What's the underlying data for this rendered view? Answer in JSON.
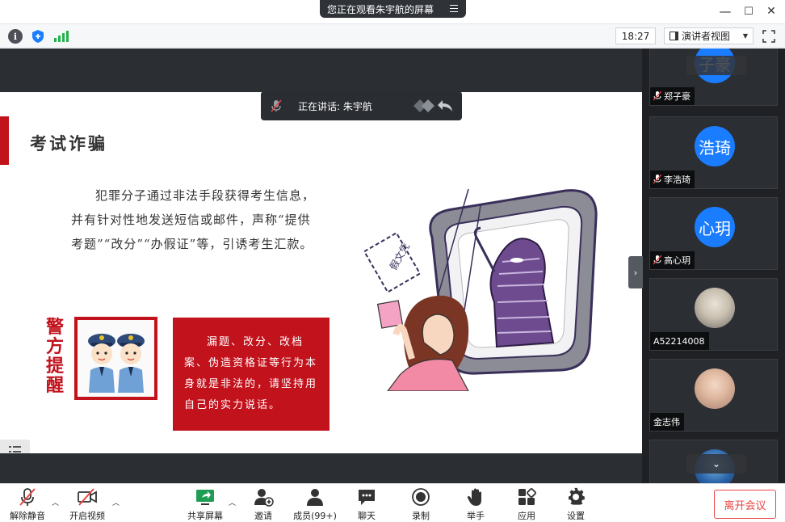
{
  "window": {
    "title": "您正在观看朱宇航的屏幕",
    "minimize": "—",
    "maximize": "☐",
    "close": "✕"
  },
  "toolbar": {
    "time": "18:27",
    "view_label": "演讲者视图"
  },
  "speaking": {
    "text": "正在讲话: 朱宇航"
  },
  "slide": {
    "title": "考试诈骗",
    "paragraph": "犯罪分子通过非法手段获得考生信息，并有针对性地发送短信或邮件，声称“提供考题”“改分”“办假证”等，引诱考生汇款。",
    "warning_vertical": "警方提醒",
    "warning_text": "漏题、改分、改档案、伪造资格证等行为本身就是非法的，请坚持用自己的实力说话。",
    "sign_text": "假文凭"
  },
  "participants": [
    {
      "avatar": "子豪",
      "name": "郑子豪",
      "muted": true
    },
    {
      "avatar": "浩琦",
      "name": "李浩琦",
      "muted": true
    },
    {
      "avatar": "心玥",
      "name": "高心玥",
      "muted": true
    },
    {
      "avatar": "",
      "name": "A52214008",
      "muted": false
    },
    {
      "avatar": "",
      "name": "金志伟",
      "muted": false
    }
  ],
  "bottombar": {
    "unmute": "解除静音",
    "start_video": "开启视频",
    "share_screen": "共享屏幕",
    "invite": "邀请",
    "members": "成员(99+)",
    "chat": "聊天",
    "record": "录制",
    "raise_hand": "举手",
    "apps": "应用",
    "settings": "设置",
    "leave": "离开会议"
  },
  "colors": {
    "accent_red": "#c2121c",
    "avatar_blue": "#1a7cff",
    "leave_red": "#e64545",
    "share_green": "#1f9d55"
  }
}
